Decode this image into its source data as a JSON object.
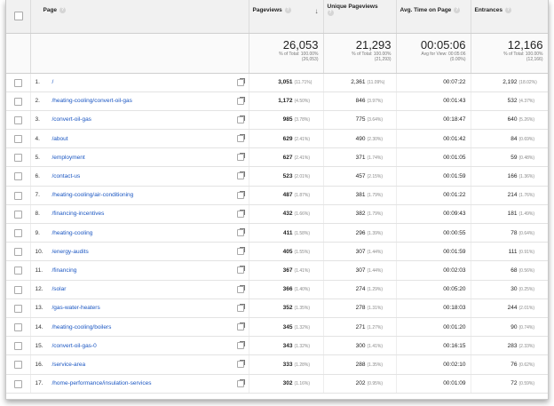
{
  "columns": {
    "page": "Page",
    "pageviews": "Pageviews",
    "unique": "Unique Pageviews",
    "avg_time": "Avg. Time on Page",
    "entrances": "Entrances"
  },
  "totals": {
    "pageviews": {
      "value": "26,053",
      "l1": "% of Total: 100.00%",
      "l2": "(26,053)"
    },
    "unique": {
      "value": "21,293",
      "l1": "% of Total: 100.00%",
      "l2": "(21,293)"
    },
    "avg_time": {
      "value": "00:05:06",
      "l1": "Avg for View: 00:05:06",
      "l2": "(0.00%)"
    },
    "entrances": {
      "value": "12,166",
      "l1": "% of Total: 100.00%",
      "l2": "(12,166)"
    }
  },
  "rows": [
    {
      "idx": "1.",
      "page": "/",
      "pv": "3,051",
      "pv_pct": "(11.71%)",
      "upv": "2,361",
      "upv_pct": "(11.09%)",
      "time": "00:07:22",
      "ent": "2,192",
      "ent_pct": "(18.02%)"
    },
    {
      "idx": "2.",
      "page": "/heating-cooling/convert-oil-gas",
      "pv": "1,172",
      "pv_pct": "(4.50%)",
      "upv": "846",
      "upv_pct": "(3.97%)",
      "time": "00:01:43",
      "ent": "532",
      "ent_pct": "(4.37%)"
    },
    {
      "idx": "3.",
      "page": "/convert-oil-gas",
      "pv": "985",
      "pv_pct": "(3.78%)",
      "upv": "775",
      "upv_pct": "(3.64%)",
      "time": "00:18:47",
      "ent": "640",
      "ent_pct": "(5.26%)"
    },
    {
      "idx": "4.",
      "page": "/about",
      "pv": "629",
      "pv_pct": "(2.41%)",
      "upv": "490",
      "upv_pct": "(2.30%)",
      "time": "00:01:42",
      "ent": "84",
      "ent_pct": "(0.69%)"
    },
    {
      "idx": "5.",
      "page": "/employment",
      "pv": "627",
      "pv_pct": "(2.41%)",
      "upv": "371",
      "upv_pct": "(1.74%)",
      "time": "00:01:05",
      "ent": "59",
      "ent_pct": "(0.48%)"
    },
    {
      "idx": "6.",
      "page": "/contact-us",
      "pv": "523",
      "pv_pct": "(2.01%)",
      "upv": "457",
      "upv_pct": "(2.15%)",
      "time": "00:01:59",
      "ent": "166",
      "ent_pct": "(1.36%)"
    },
    {
      "idx": "7.",
      "page": "/heating-cooling/air-conditioning",
      "pv": "487",
      "pv_pct": "(1.87%)",
      "upv": "381",
      "upv_pct": "(1.79%)",
      "time": "00:01:22",
      "ent": "214",
      "ent_pct": "(1.76%)"
    },
    {
      "idx": "8.",
      "page": "/financing-incentives",
      "pv": "432",
      "pv_pct": "(1.66%)",
      "upv": "382",
      "upv_pct": "(1.79%)",
      "time": "00:09:43",
      "ent": "181",
      "ent_pct": "(1.49%)"
    },
    {
      "idx": "9.",
      "page": "/heating-cooling",
      "pv": "411",
      "pv_pct": "(1.58%)",
      "upv": "296",
      "upv_pct": "(1.39%)",
      "time": "00:00:55",
      "ent": "78",
      "ent_pct": "(0.64%)"
    },
    {
      "idx": "10.",
      "page": "/energy-audits",
      "pv": "405",
      "pv_pct": "(1.55%)",
      "upv": "307",
      "upv_pct": "(1.44%)",
      "time": "00:01:59",
      "ent": "111",
      "ent_pct": "(0.91%)"
    },
    {
      "idx": "11.",
      "page": "/financing",
      "pv": "367",
      "pv_pct": "(1.41%)",
      "upv": "307",
      "upv_pct": "(1.44%)",
      "time": "00:02:03",
      "ent": "68",
      "ent_pct": "(0.56%)"
    },
    {
      "idx": "12.",
      "page": "/solar",
      "pv": "366",
      "pv_pct": "(1.40%)",
      "upv": "274",
      "upv_pct": "(1.29%)",
      "time": "00:05:20",
      "ent": "30",
      "ent_pct": "(0.25%)"
    },
    {
      "idx": "13.",
      "page": "/gas-water-heaters",
      "pv": "352",
      "pv_pct": "(1.35%)",
      "upv": "278",
      "upv_pct": "(1.31%)",
      "time": "00:18:03",
      "ent": "244",
      "ent_pct": "(2.01%)"
    },
    {
      "idx": "14.",
      "page": "/heating-cooling/boilers",
      "pv": "345",
      "pv_pct": "(1.32%)",
      "upv": "271",
      "upv_pct": "(1.27%)",
      "time": "00:01:20",
      "ent": "90",
      "ent_pct": "(0.74%)"
    },
    {
      "idx": "15.",
      "page": "/convert-oil-gas-0",
      "pv": "343",
      "pv_pct": "(1.32%)",
      "upv": "300",
      "upv_pct": "(1.41%)",
      "time": "00:16:15",
      "ent": "283",
      "ent_pct": "(2.33%)"
    },
    {
      "idx": "16.",
      "page": "/service-area",
      "pv": "333",
      "pv_pct": "(1.28%)",
      "upv": "288",
      "upv_pct": "(1.35%)",
      "time": "00:02:10",
      "ent": "76",
      "ent_pct": "(0.62%)"
    },
    {
      "idx": "17.",
      "page": "/home-performance/insulation-services",
      "pv": "302",
      "pv_pct": "(1.16%)",
      "upv": "202",
      "upv_pct": "(0.95%)",
      "time": "00:01:09",
      "ent": "72",
      "ent_pct": "(0.59%)"
    }
  ]
}
